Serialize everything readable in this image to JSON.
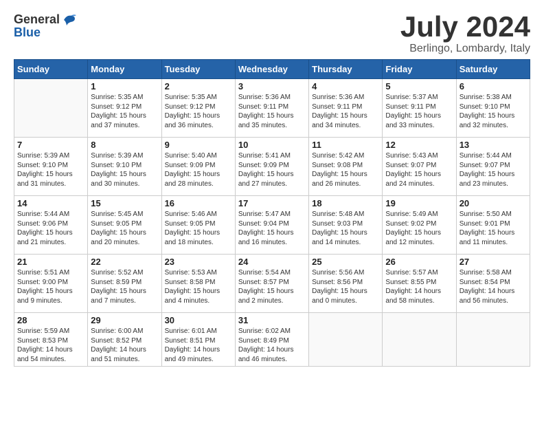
{
  "header": {
    "logo_general": "General",
    "logo_blue": "Blue",
    "month_title": "July 2024",
    "location": "Berlingo, Lombardy, Italy"
  },
  "weekdays": [
    "Sunday",
    "Monday",
    "Tuesday",
    "Wednesday",
    "Thursday",
    "Friday",
    "Saturday"
  ],
  "weeks": [
    [
      {
        "day": "",
        "lines": []
      },
      {
        "day": "1",
        "lines": [
          "Sunrise: 5:35 AM",
          "Sunset: 9:12 PM",
          "Daylight: 15 hours",
          "and 37 minutes."
        ]
      },
      {
        "day": "2",
        "lines": [
          "Sunrise: 5:35 AM",
          "Sunset: 9:12 PM",
          "Daylight: 15 hours",
          "and 36 minutes."
        ]
      },
      {
        "day": "3",
        "lines": [
          "Sunrise: 5:36 AM",
          "Sunset: 9:11 PM",
          "Daylight: 15 hours",
          "and 35 minutes."
        ]
      },
      {
        "day": "4",
        "lines": [
          "Sunrise: 5:36 AM",
          "Sunset: 9:11 PM",
          "Daylight: 15 hours",
          "and 34 minutes."
        ]
      },
      {
        "day": "5",
        "lines": [
          "Sunrise: 5:37 AM",
          "Sunset: 9:11 PM",
          "Daylight: 15 hours",
          "and 33 minutes."
        ]
      },
      {
        "day": "6",
        "lines": [
          "Sunrise: 5:38 AM",
          "Sunset: 9:10 PM",
          "Daylight: 15 hours",
          "and 32 minutes."
        ]
      }
    ],
    [
      {
        "day": "7",
        "lines": [
          "Sunrise: 5:39 AM",
          "Sunset: 9:10 PM",
          "Daylight: 15 hours",
          "and 31 minutes."
        ]
      },
      {
        "day": "8",
        "lines": [
          "Sunrise: 5:39 AM",
          "Sunset: 9:10 PM",
          "Daylight: 15 hours",
          "and 30 minutes."
        ]
      },
      {
        "day": "9",
        "lines": [
          "Sunrise: 5:40 AM",
          "Sunset: 9:09 PM",
          "Daylight: 15 hours",
          "and 28 minutes."
        ]
      },
      {
        "day": "10",
        "lines": [
          "Sunrise: 5:41 AM",
          "Sunset: 9:09 PM",
          "Daylight: 15 hours",
          "and 27 minutes."
        ]
      },
      {
        "day": "11",
        "lines": [
          "Sunrise: 5:42 AM",
          "Sunset: 9:08 PM",
          "Daylight: 15 hours",
          "and 26 minutes."
        ]
      },
      {
        "day": "12",
        "lines": [
          "Sunrise: 5:43 AM",
          "Sunset: 9:07 PM",
          "Daylight: 15 hours",
          "and 24 minutes."
        ]
      },
      {
        "day": "13",
        "lines": [
          "Sunrise: 5:44 AM",
          "Sunset: 9:07 PM",
          "Daylight: 15 hours",
          "and 23 minutes."
        ]
      }
    ],
    [
      {
        "day": "14",
        "lines": [
          "Sunrise: 5:44 AM",
          "Sunset: 9:06 PM",
          "Daylight: 15 hours",
          "and 21 minutes."
        ]
      },
      {
        "day": "15",
        "lines": [
          "Sunrise: 5:45 AM",
          "Sunset: 9:05 PM",
          "Daylight: 15 hours",
          "and 20 minutes."
        ]
      },
      {
        "day": "16",
        "lines": [
          "Sunrise: 5:46 AM",
          "Sunset: 9:05 PM",
          "Daylight: 15 hours",
          "and 18 minutes."
        ]
      },
      {
        "day": "17",
        "lines": [
          "Sunrise: 5:47 AM",
          "Sunset: 9:04 PM",
          "Daylight: 15 hours",
          "and 16 minutes."
        ]
      },
      {
        "day": "18",
        "lines": [
          "Sunrise: 5:48 AM",
          "Sunset: 9:03 PM",
          "Daylight: 15 hours",
          "and 14 minutes."
        ]
      },
      {
        "day": "19",
        "lines": [
          "Sunrise: 5:49 AM",
          "Sunset: 9:02 PM",
          "Daylight: 15 hours",
          "and 12 minutes."
        ]
      },
      {
        "day": "20",
        "lines": [
          "Sunrise: 5:50 AM",
          "Sunset: 9:01 PM",
          "Daylight: 15 hours",
          "and 11 minutes."
        ]
      }
    ],
    [
      {
        "day": "21",
        "lines": [
          "Sunrise: 5:51 AM",
          "Sunset: 9:00 PM",
          "Daylight: 15 hours",
          "and 9 minutes."
        ]
      },
      {
        "day": "22",
        "lines": [
          "Sunrise: 5:52 AM",
          "Sunset: 8:59 PM",
          "Daylight: 15 hours",
          "and 7 minutes."
        ]
      },
      {
        "day": "23",
        "lines": [
          "Sunrise: 5:53 AM",
          "Sunset: 8:58 PM",
          "Daylight: 15 hours",
          "and 4 minutes."
        ]
      },
      {
        "day": "24",
        "lines": [
          "Sunrise: 5:54 AM",
          "Sunset: 8:57 PM",
          "Daylight: 15 hours",
          "and 2 minutes."
        ]
      },
      {
        "day": "25",
        "lines": [
          "Sunrise: 5:56 AM",
          "Sunset: 8:56 PM",
          "Daylight: 15 hours",
          "and 0 minutes."
        ]
      },
      {
        "day": "26",
        "lines": [
          "Sunrise: 5:57 AM",
          "Sunset: 8:55 PM",
          "Daylight: 14 hours",
          "and 58 minutes."
        ]
      },
      {
        "day": "27",
        "lines": [
          "Sunrise: 5:58 AM",
          "Sunset: 8:54 PM",
          "Daylight: 14 hours",
          "and 56 minutes."
        ]
      }
    ],
    [
      {
        "day": "28",
        "lines": [
          "Sunrise: 5:59 AM",
          "Sunset: 8:53 PM",
          "Daylight: 14 hours",
          "and 54 minutes."
        ]
      },
      {
        "day": "29",
        "lines": [
          "Sunrise: 6:00 AM",
          "Sunset: 8:52 PM",
          "Daylight: 14 hours",
          "and 51 minutes."
        ]
      },
      {
        "day": "30",
        "lines": [
          "Sunrise: 6:01 AM",
          "Sunset: 8:51 PM",
          "Daylight: 14 hours",
          "and 49 minutes."
        ]
      },
      {
        "day": "31",
        "lines": [
          "Sunrise: 6:02 AM",
          "Sunset: 8:49 PM",
          "Daylight: 14 hours",
          "and 46 minutes."
        ]
      },
      {
        "day": "",
        "lines": []
      },
      {
        "day": "",
        "lines": []
      },
      {
        "day": "",
        "lines": []
      }
    ]
  ]
}
